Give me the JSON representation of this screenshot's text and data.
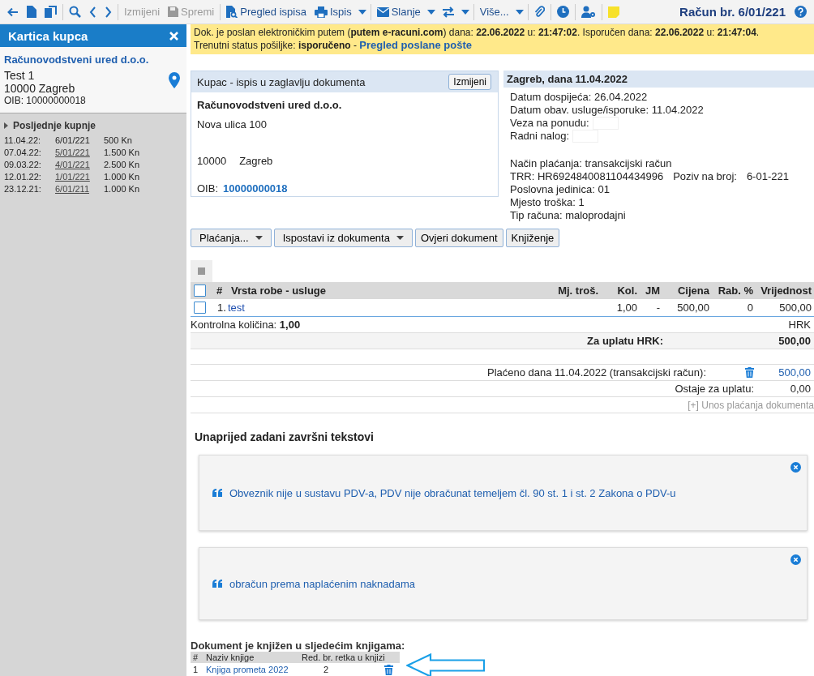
{
  "toolbar": {
    "buttons": [
      {
        "label": "Izmijeni",
        "disabled": true
      },
      {
        "label": "Spremi",
        "disabled": true
      },
      {
        "label": "Pregled ispisa",
        "disabled": false
      },
      {
        "label": "Ispis",
        "disabled": false
      },
      {
        "label": "Slanje",
        "disabled": false
      },
      {
        "label": "Više...",
        "disabled": false
      }
    ],
    "title": "Račun br. 6/01/221"
  },
  "sidebar": {
    "title": "Kartica kupca",
    "customer": {
      "name": "Računovodstveni ured d.o.o.",
      "line1": "Test 1",
      "city": "10000 Zagreb",
      "oib": "OIB: 10000000018"
    },
    "recent": {
      "title": "Posljednje kupnje",
      "rows": [
        {
          "date": "11.04.22:",
          "number": "6/01/221",
          "amount": "500 Kn",
          "current": true
        },
        {
          "date": "07.04.22:",
          "number": "5/01/221",
          "amount": "1.500 Kn",
          "current": false
        },
        {
          "date": "09.03.22:",
          "number": "4/01/221",
          "amount": "2.500 Kn",
          "current": false
        },
        {
          "date": "12.01.22:",
          "number": "1/01/221",
          "amount": "1.000 Kn",
          "current": false
        },
        {
          "date": "23.12.21:",
          "number": "6/01/211",
          "amount": "1.000 Kn",
          "current": false
        }
      ]
    }
  },
  "notice": {
    "line1": "Dok. je poslan elektroničkim putem (**putem e-racuni.com**) dana: **22.06.2022** u: **21:47:02**. Isporučen dana: **22.06.2022** u: **21:47:04**.",
    "line2": "Trenutni status pošiljke: **isporučeno** -",
    "link": "Pregled poslane pošte"
  },
  "buyer": {
    "title": "Kupac - ispis u zaglavlju dokumenta",
    "button": "Izmijeni",
    "name": "Računovodstveni ured d.o.o.",
    "street": "Nova ulica 100",
    "postcode": "10000",
    "city": "Zagreb",
    "oib_label": "OIB:",
    "oib": "10000000018"
  },
  "info": {
    "title": "Zagreb, dana 11.04.2022",
    "groups": [
      [
        {
          "kind": "text",
          "text": "Datum dospijeća: 26.04.2022"
        },
        {
          "kind": "text",
          "text": "Datum obav. usluge/isporuke: 11.04.2022"
        },
        {
          "kind": "field",
          "text": "Veza na ponudu:"
        },
        {
          "kind": "field",
          "text": "Radni nalog:"
        }
      ],
      [
        {
          "kind": "text",
          "text": "Način plaćanja: transakcijski račun"
        },
        {
          "kind": "pair",
          "text": "TRR: HR6924840081104434996",
          "label": "Poziv na broj:",
          "value": "6-01-221"
        },
        {
          "kind": "text",
          "text": "Poslovna jedinica: 01"
        },
        {
          "kind": "text",
          "text": "Mjesto troška: 1"
        },
        {
          "kind": "text",
          "text": "Tip računa: maloprodajni"
        }
      ]
    ]
  },
  "actions": [
    {
      "label": "Plaćanja...",
      "dropdown": true
    },
    {
      "label": "Ispostavi iz dokumenta",
      "dropdown": true
    },
    {
      "label": "Ovjeri dokument",
      "dropdown": false
    },
    {
      "label": "Knjiženje",
      "dropdown": false
    }
  ],
  "items": {
    "all_checked": false,
    "columns": [
      "#",
      "Vrsta robe - usluge",
      "Mj. troš.",
      "Kol.",
      "JM",
      "Cijena",
      "Rab. %",
      "Vrijednost"
    ],
    "rows": [
      {
        "checked": false,
        "num": "1.",
        "name": "test",
        "qty": "1,00",
        "unit": "-",
        "price": "500,00",
        "discount": "0",
        "value": "500,00"
      }
    ],
    "control_label": "Kontrolna količina:",
    "control_value": "1,00",
    "currency": "HRK",
    "total_label": "Za uplatu HRK:",
    "total": "500,00",
    "payment_label": "Plaćeno dana 11.04.2022 (transakcijski račun):",
    "payment": "500,00",
    "remaining_label": "Ostaje za uplatu:",
    "remaining": "0,00",
    "add_payment": "[+] Unos plaćanja dokumenta"
  },
  "closing": {
    "title": "Unaprijed zadani završni tekstovi",
    "texts": [
      "Obveznik nije u sustavu PDV-a, PDV nije obračunat temeljem čl. 90 st. 1 i st. 2 Zakona o PDV-u",
      "obračun prema naplaćenim naknadama"
    ]
  },
  "books": {
    "title": "Dokument je knjižen u sljedećim knjigama:",
    "columns": [
      "#",
      "Naziv knjige",
      "Red. br. retka u knjizi"
    ],
    "rows": [
      {
        "num": "1",
        "name": "Knjiga prometa 2022",
        "line": "2"
      }
    ]
  }
}
